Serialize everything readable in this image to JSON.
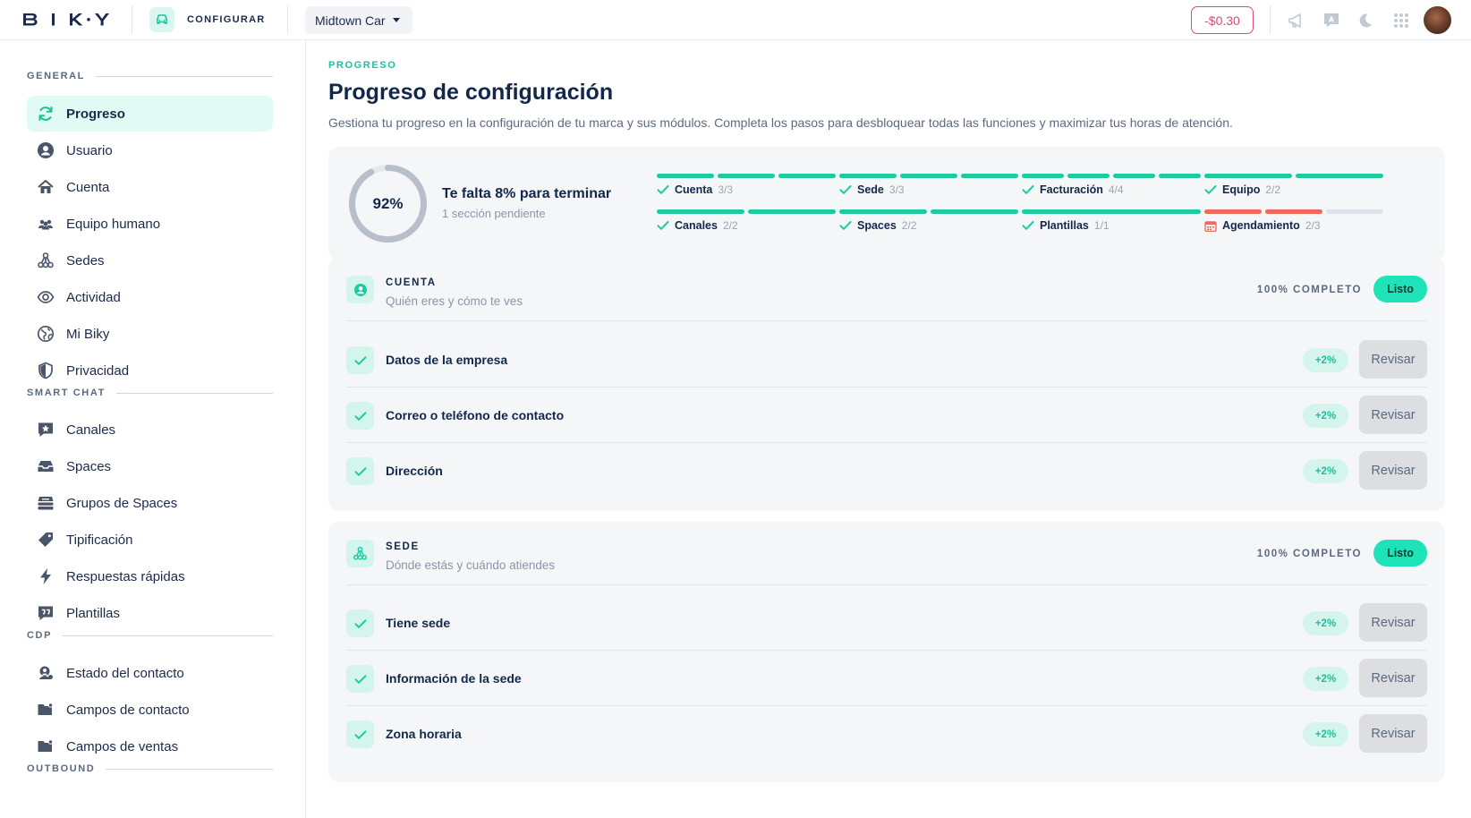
{
  "topbar": {
    "logo": "BIKY",
    "section_label": "CONFIGURAR",
    "brand": "Midtown Car",
    "balance": "-$0.30",
    "icons": [
      "megaphone-icon",
      "translate-icon",
      "moon-icon",
      "apps-grid-icon"
    ]
  },
  "sidebar": {
    "sections": [
      {
        "title": "GENERAL",
        "items": [
          {
            "label": "Progreso",
            "icon": "refresh-icon",
            "active": true
          },
          {
            "label": "Usuario",
            "icon": "user-circle-icon"
          },
          {
            "label": "Cuenta",
            "icon": "home-icon"
          },
          {
            "label": "Equipo humano",
            "icon": "team-icon"
          },
          {
            "label": "Sedes",
            "icon": "sites-icon"
          },
          {
            "label": "Actividad",
            "icon": "eye-icon"
          },
          {
            "label": "Mi Biky",
            "icon": "globe-icon"
          },
          {
            "label": "Privacidad",
            "icon": "shield-icon"
          }
        ]
      },
      {
        "title": "SMART CHAT",
        "items": [
          {
            "label": "Canales",
            "icon": "chat-star-icon"
          },
          {
            "label": "Spaces",
            "icon": "inbox-icon"
          },
          {
            "label": "Grupos de Spaces",
            "icon": "stack-icon"
          },
          {
            "label": "Tipificación",
            "icon": "tag-icon"
          },
          {
            "label": "Respuestas rápidas",
            "icon": "bolt-icon"
          },
          {
            "label": "Plantillas",
            "icon": "quote-icon"
          }
        ]
      },
      {
        "title": "CDP",
        "items": [
          {
            "label": "Estado del contacto",
            "icon": "contact-status-icon"
          },
          {
            "label": "Campos de contacto",
            "icon": "folder-user-icon"
          },
          {
            "label": "Campos de ventas",
            "icon": "folder-sales-icon"
          }
        ]
      },
      {
        "title": "OUTBOUND",
        "items": []
      }
    ]
  },
  "main": {
    "eyebrow": "PROGRESO",
    "title": "Progreso de configuración",
    "subtitle": "Gestiona tu progreso en la configuración de tu marca y sus módulos. Completa los pasos para desbloquear todas las funciones y maximizar tus horas de atención.",
    "summary": {
      "percent_label": "92%",
      "percent": 92,
      "headline": "Te falta 8% para terminar",
      "pending": "1 sección pendiente",
      "modules": [
        {
          "name": "Cuenta",
          "count": "3/3",
          "done": 3,
          "total": 3
        },
        {
          "name": "Sede",
          "count": "3/3",
          "done": 3,
          "total": 3
        },
        {
          "name": "Facturación",
          "count": "4/4",
          "done": 4,
          "total": 4
        },
        {
          "name": "Equipo",
          "count": "2/2",
          "done": 2,
          "total": 2
        },
        {
          "name": "Canales",
          "count": "2/2",
          "done": 2,
          "total": 2
        },
        {
          "name": "Spaces",
          "count": "2/2",
          "done": 2,
          "total": 2
        },
        {
          "name": "Plantillas",
          "count": "1/1",
          "done": 1,
          "total": 1
        },
        {
          "name": "Agendamiento",
          "count": "2/3",
          "done": 2,
          "total": 3
        }
      ]
    },
    "cards": [
      {
        "title": "CUENTA",
        "subtitle": "Quién eres y cómo te ves",
        "icon": "user-circle-icon",
        "status": "100% COMPLETO",
        "pill": "Listo",
        "tasks": [
          {
            "name": "Datos de la empresa",
            "points": "+2%",
            "action": "Revisar"
          },
          {
            "name": "Correo o teléfono de contacto",
            "points": "+2%",
            "action": "Revisar"
          },
          {
            "name": "Dirección",
            "points": "+2%",
            "action": "Revisar"
          }
        ]
      },
      {
        "title": "SEDE",
        "subtitle": "Dónde estás y cuándo atiendes",
        "icon": "sites-icon",
        "status": "100% COMPLETO",
        "pill": "Listo",
        "tasks": [
          {
            "name": "Tiene sede",
            "points": "+2%",
            "action": "Revisar"
          },
          {
            "name": "Información de la sede",
            "points": "+2%",
            "action": "Revisar"
          },
          {
            "name": "Zona horaria",
            "points": "+2%",
            "action": "Revisar"
          }
        ]
      }
    ]
  },
  "colors": {
    "accent": "#1fc9a2",
    "accent_light": "#d4f5ec",
    "pill": "#1fe3b8",
    "warning": "#ee6b5b",
    "balance": "#e5467a",
    "text": "#11284b"
  }
}
